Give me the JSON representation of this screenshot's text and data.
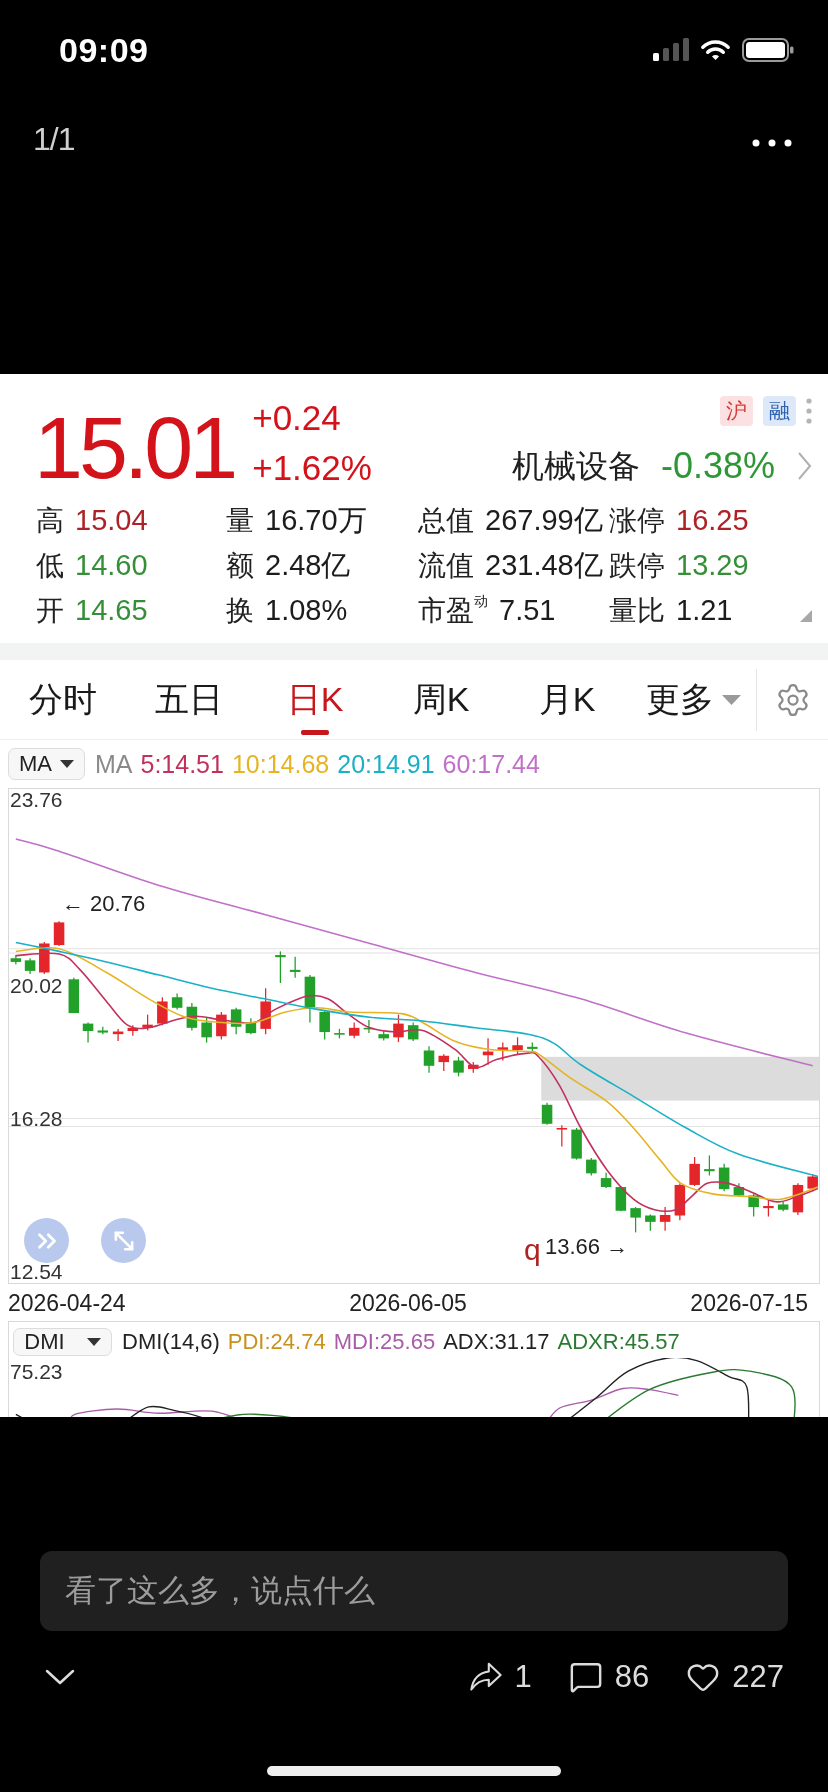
{
  "status_bar": {
    "time": "09:09"
  },
  "viewer": {
    "page_counter": "1/1"
  },
  "quote": {
    "price": "15.01",
    "change": "+0.24",
    "change_percent": "+1.62%",
    "rising": true,
    "tags": [
      {
        "label": "沪",
        "kind": "exchange"
      },
      {
        "label": "融",
        "kind": "margin"
      }
    ],
    "sector": {
      "name": "机械设备",
      "change": "-0.38%",
      "rising": false
    },
    "stats": [
      {
        "label": "高",
        "value": "15.04",
        "color": "#ad2226"
      },
      {
        "label": "量",
        "value": "16.70万",
        "color": "#1c1c1c"
      },
      {
        "label": "总值",
        "value": "267.99亿",
        "color": "#1c1c1c"
      },
      {
        "label": "涨停",
        "value": "16.25",
        "color": "#ad2226"
      },
      {
        "label": "低",
        "value": "14.60",
        "color": "#358f38"
      },
      {
        "label": "额",
        "value": "2.48亿",
        "color": "#1c1c1c"
      },
      {
        "label": "流值",
        "value": "231.48亿",
        "color": "#1c1c1c"
      },
      {
        "label": "跌停",
        "value": "13.29",
        "color": "#358f38"
      },
      {
        "label": "开",
        "value": "14.65",
        "color": "#358f38"
      },
      {
        "label": "换",
        "value": "1.08%",
        "color": "#1c1c1c"
      },
      {
        "label": "市盈$^{动}$",
        "value": "7.51",
        "color": "#1c1c1c"
      },
      {
        "label": "量比",
        "value": "1.21",
        "color": "#1c1c1c"
      }
    ]
  },
  "tabs": [
    {
      "label": "分时",
      "kind": "period",
      "selected": false
    },
    {
      "label": "五日",
      "kind": "period",
      "selected": false
    },
    {
      "label": "日K",
      "kind": "period",
      "selected": true
    },
    {
      "label": "周K",
      "kind": "period",
      "selected": false
    },
    {
      "label": "月K",
      "kind": "period",
      "selected": false
    },
    {
      "label": "更多",
      "kind": "menu",
      "selected": false
    }
  ],
  "main_indicator": {
    "selector": "MA",
    "name": "MA",
    "values": [
      {
        "text": "5:14.51",
        "color": "#c2305c"
      },
      {
        "text": "10:14.68",
        "color": "#e6b422"
      },
      {
        "text": "20:14.91",
        "color": "#1ab0c6"
      },
      {
        "text": "60:17.44",
        "color": "#c070c8"
      }
    ]
  },
  "kline_chart": {
    "y_labels": [
      "23.76",
      "20.02",
      "16.28",
      "12.54"
    ],
    "high_marker": "← 20.76",
    "low_marker": "13.66 →",
    "signal_mark": "q",
    "dates": [
      "2026-04-24",
      "2026-06-05",
      "2026-07-15"
    ]
  },
  "sub_indicator": {
    "selector": "DMI",
    "name": "DMI(14,6)",
    "values": [
      {
        "text": "PDI:24.74",
        "color": "#c8901c"
      },
      {
        "text": "MDI:25.65",
        "color": "#a85ca8"
      },
      {
        "text": "ADX:31.17",
        "color": "#222222"
      },
      {
        "text": "ADXR:45.57",
        "color": "#2a7a32"
      }
    ],
    "y_label": "75.23"
  },
  "comment_box": {
    "placeholder": "看了这么多，说点什么"
  },
  "actions": [
    {
      "kind": "share",
      "count": "1"
    },
    {
      "kind": "comment",
      "count": "86"
    },
    {
      "kind": "like",
      "count": "227"
    }
  ]
}
